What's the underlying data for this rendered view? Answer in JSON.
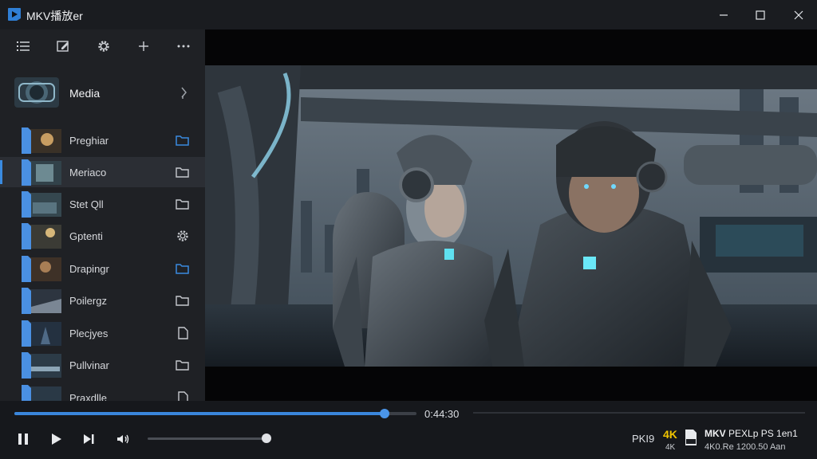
{
  "window": {
    "title": "MKV播放er",
    "minimize_icon": "minimize-icon",
    "maximize_icon": "maximize-icon",
    "close_icon": "close-icon"
  },
  "sidebar": {
    "toolbar_icons": [
      "list-icon",
      "edit-icon",
      "settings-icon",
      "add-icon",
      "more-icon"
    ],
    "media_header": {
      "label": "Media",
      "icon": "chevron-right-icon"
    },
    "items": [
      {
        "label": "Preghiar",
        "icon": "folder-open-icon",
        "accent": true
      },
      {
        "label": "Meriaco",
        "icon": "folder-icon",
        "selected": true
      },
      {
        "label": "Stet Qll",
        "icon": "folder-icon"
      },
      {
        "label": "Gptenti",
        "icon": "gear-icon"
      },
      {
        "label": "Drapingr",
        "icon": "folder-open-icon",
        "accent": true
      },
      {
        "label": "Poilergz",
        "icon": "folder-icon"
      },
      {
        "label": "Plecjyes",
        "icon": "file-icon"
      },
      {
        "label": "Pullvinar",
        "icon": "folder-icon"
      },
      {
        "label": "Praxdlle",
        "icon": "file-icon"
      }
    ]
  },
  "player": {
    "time": "0:44:30",
    "progress": 0.92,
    "volume": 0.99,
    "format_label": "PKI9",
    "badge_4k": "4K",
    "badge_4k_sub": "4K",
    "info_line1_bold": "MKV",
    "info_line1": "PEXLp PS 1en1",
    "info_line2": "4K0.Re 1200.50 Aan"
  },
  "colors": {
    "accent": "#3a86db",
    "badge": "#f0c400",
    "sidebar_bg": "#1f2125",
    "titlebar_bg": "#1a1c20"
  }
}
